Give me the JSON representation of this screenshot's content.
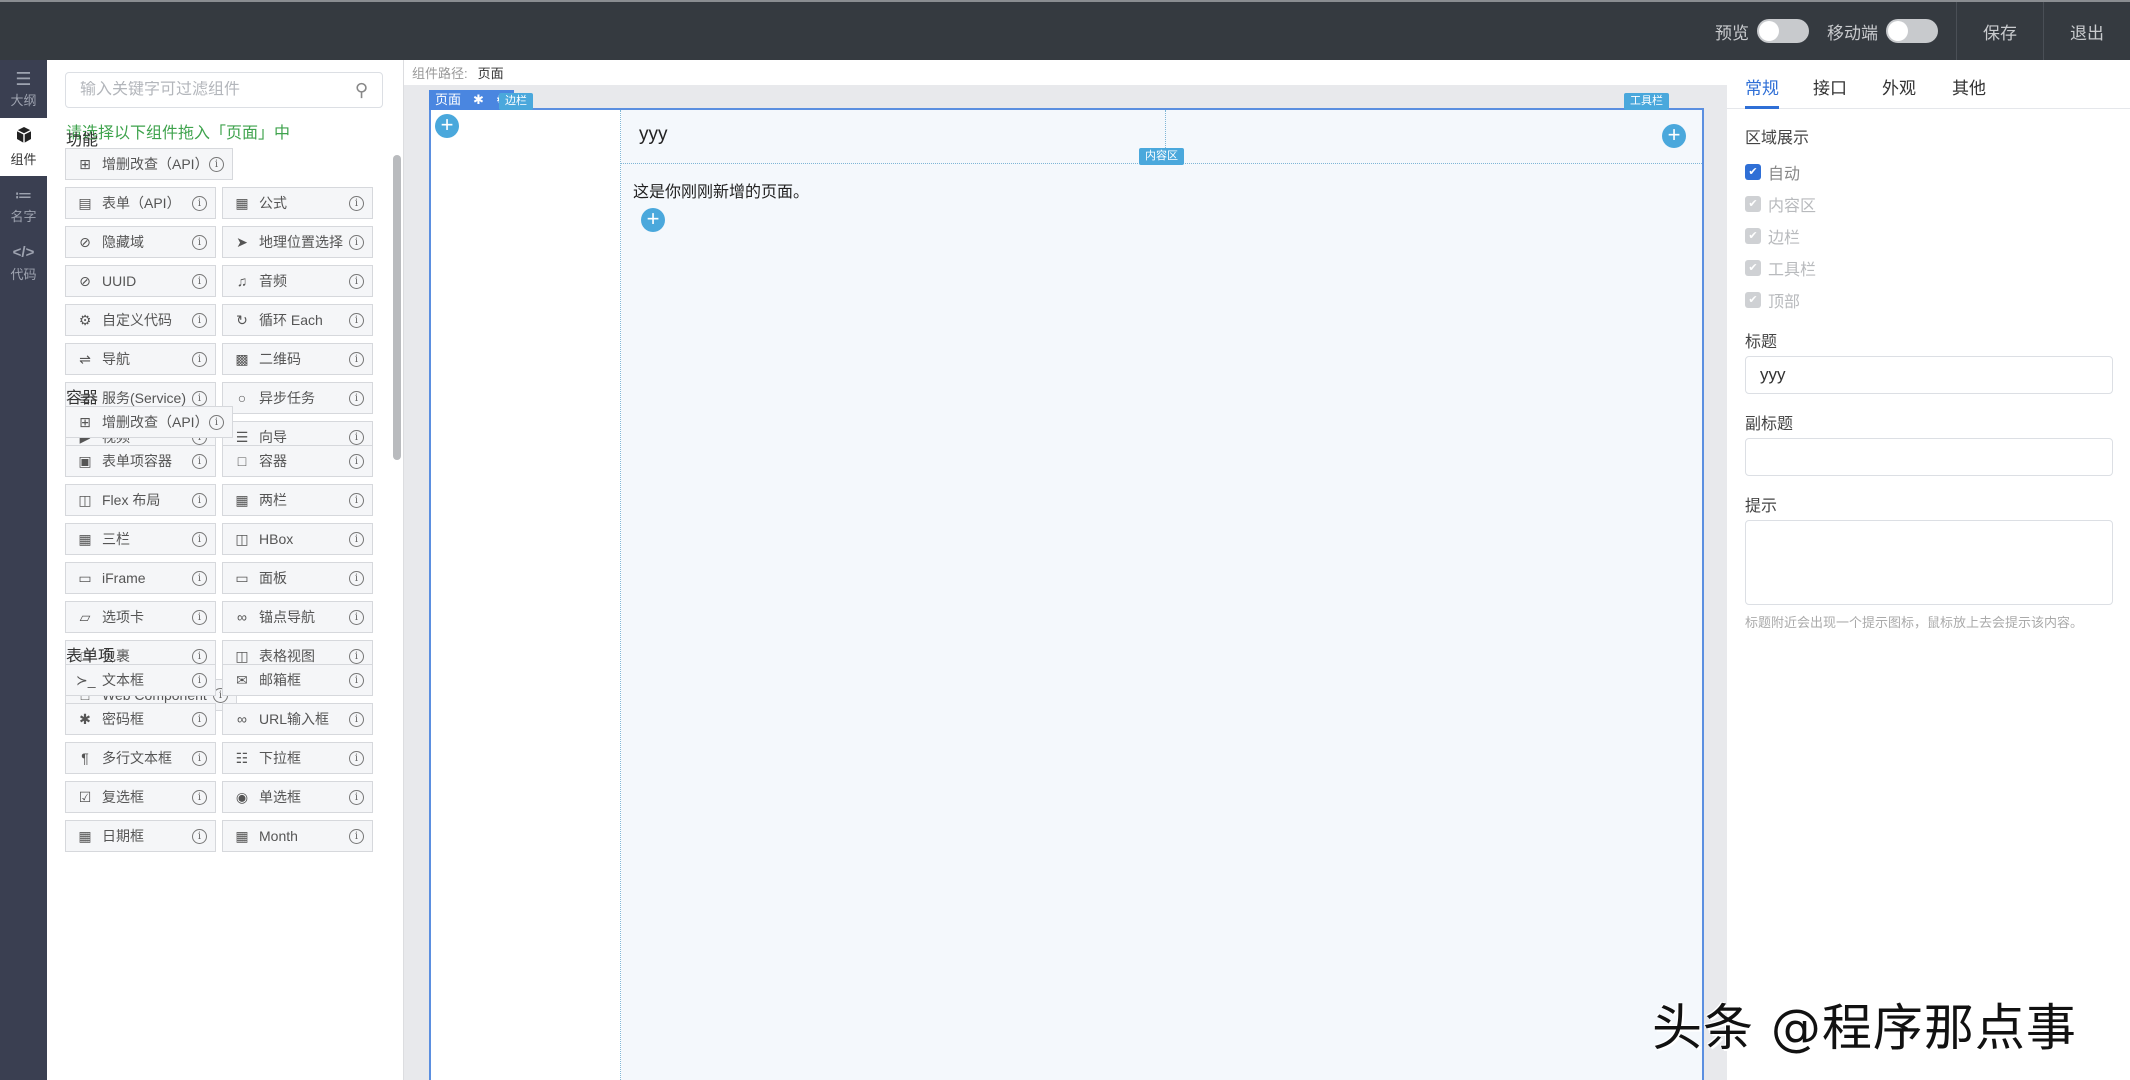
{
  "header": {
    "preview_label": "预览",
    "preview_on": false,
    "mobile_label": "移动端",
    "mobile_on": false,
    "save_label": "保存",
    "exit_label": "退出"
  },
  "rail": {
    "items": [
      {
        "label": "大纲",
        "icon": "outline-icon",
        "active": false
      },
      {
        "label": "组件",
        "icon": "cube-icon",
        "active": true
      },
      {
        "label": "名字",
        "icon": "list-icon",
        "active": false
      },
      {
        "label": "代码",
        "icon": "code-icon",
        "active": false
      }
    ]
  },
  "panel": {
    "search_placeholder": "输入关键字可过滤组件",
    "search_value": "",
    "hint": "请选择以下组件拖入「页面」中",
    "groups": [
      {
        "title": "功能",
        "items": [
          {
            "label": "增删改查（API）",
            "icon": "crud-icon"
          },
          {
            "label": "表单（API）",
            "icon": "form-icon"
          },
          {
            "label": "公式",
            "icon": "calculator-icon"
          },
          {
            "label": "隐藏域",
            "icon": "eye-slash-icon"
          },
          {
            "label": "地理位置选择",
            "icon": "location-arrow-icon"
          },
          {
            "label": "UUID",
            "icon": "eye-slash-icon"
          },
          {
            "label": "音频",
            "icon": "music-icon"
          },
          {
            "label": "自定义代码",
            "icon": "cogs-icon"
          },
          {
            "label": "循环 Each",
            "icon": "redo-icon"
          },
          {
            "label": "导航",
            "icon": "signpost-icon"
          },
          {
            "label": "二维码",
            "icon": "qrcode-icon"
          },
          {
            "label": "服务(Service)",
            "icon": "server-icon"
          },
          {
            "label": "异步任务",
            "icon": "circle-icon"
          },
          {
            "label": "视频",
            "icon": "video-icon"
          },
          {
            "label": "向导",
            "icon": "list-ol-icon"
          }
        ]
      },
      {
        "title": "容器",
        "items": [
          {
            "label": "增删改查（API）",
            "icon": "crud-icon"
          },
          {
            "label": "表单项容器",
            "icon": "object-group-icon"
          },
          {
            "label": "容器",
            "icon": "square-icon"
          },
          {
            "label": "Flex 布局",
            "icon": "columns-icon"
          },
          {
            "label": "两栏",
            "icon": "th-icon"
          },
          {
            "label": "三栏",
            "icon": "th-icon"
          },
          {
            "label": "HBox",
            "icon": "columns-icon"
          },
          {
            "label": "iFrame",
            "icon": "window-icon"
          },
          {
            "label": "面板",
            "icon": "window-icon"
          },
          {
            "label": "选项卡",
            "icon": "folder-icon"
          },
          {
            "label": "锚点导航",
            "icon": "link-icon"
          },
          {
            "label": "包裹",
            "icon": "square-icon"
          },
          {
            "label": "表格视图",
            "icon": "columns-icon"
          },
          {
            "label": "Web Component",
            "icon": "square-icon"
          }
        ]
      },
      {
        "title": "表单项",
        "items": [
          {
            "label": "文本框",
            "icon": "terminal-icon"
          },
          {
            "label": "邮箱框",
            "icon": "envelope-icon"
          },
          {
            "label": "密码框",
            "icon": "asterisk-icon"
          },
          {
            "label": "URL输入框",
            "icon": "link-icon"
          },
          {
            "label": "多行文本框",
            "icon": "paragraph-icon"
          },
          {
            "label": "下拉框",
            "icon": "list-icon"
          },
          {
            "label": "复选框",
            "icon": "check-square-icon"
          },
          {
            "label": "单选框",
            "icon": "dot-circle-icon"
          },
          {
            "label": "日期框",
            "icon": "calendar-icon"
          },
          {
            "label": "Month",
            "icon": "calendar-icon"
          }
        ]
      }
    ],
    "info_glyph": "i"
  },
  "canvas": {
    "path_label": "组件路径:",
    "path_value": "页面",
    "page_badge": "页面",
    "aside_tag": "边栏",
    "toolbar_tag": "工具栏",
    "content_tag": "内容区",
    "page_title": "yyy",
    "body_text": "这是你刚刚新增的页面。"
  },
  "rpanel": {
    "tabs": [
      {
        "label": "常规",
        "active": true
      },
      {
        "label": "接口",
        "active": false
      },
      {
        "label": "外观",
        "active": false
      },
      {
        "label": "其他",
        "active": false
      }
    ],
    "region_label": "区域展示",
    "regions": [
      {
        "label": "自动",
        "checked": true,
        "disabled": false
      },
      {
        "label": "内容区",
        "checked": true,
        "disabled": true
      },
      {
        "label": "边栏",
        "checked": true,
        "disabled": true
      },
      {
        "label": "工具栏",
        "checked": true,
        "disabled": true
      },
      {
        "label": "顶部",
        "checked": true,
        "disabled": true
      }
    ],
    "title_label": "标题",
    "title_value": "yyy",
    "subtitle_label": "副标题",
    "subtitle_value": "",
    "remark_label": "提示",
    "remark_value": "",
    "remark_help": "标题附近会出现一个提示图标，鼠标放上去会提示该内容。"
  },
  "watermark": "头条 @程序那点事",
  "colors": {
    "accent": "#2f6fd6",
    "hint_green": "#3fa34d",
    "add_blue": "#4aa8dc",
    "header_bg": "#353a40"
  }
}
